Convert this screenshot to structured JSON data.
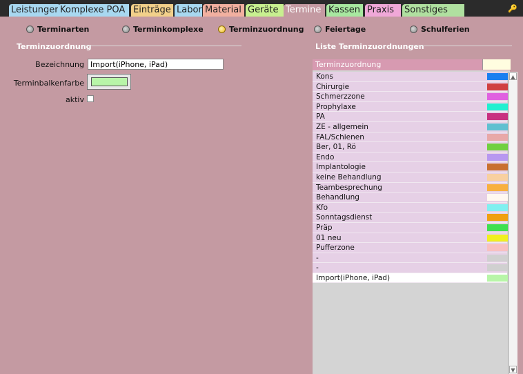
{
  "tabs": [
    {
      "label": "Leistungen",
      "color": "#a8d8f0"
    },
    {
      "label": "Komplexe POA",
      "color": "#a8d8f0"
    },
    {
      "label": "Einträge",
      "color": "#f2d08a"
    },
    {
      "label": "Labor",
      "color": "#a8d8f0"
    },
    {
      "label": "Material",
      "color": "#f2b0a0"
    },
    {
      "label": "Geräte",
      "color": "#c8f090"
    },
    {
      "label": "Termine",
      "color": "#c49aa2",
      "active": true
    },
    {
      "label": "Kassen",
      "color": "#a8e8a0"
    },
    {
      "label": "Praxis",
      "color": "#f0a8d8"
    },
    {
      "label": "Sonstiges",
      "color": "#b0e0a0"
    }
  ],
  "toolbar_icon": "key-icon",
  "radios": [
    {
      "label": "Terminarten",
      "selected": false
    },
    {
      "label": "Terminkomplexe",
      "selected": false
    },
    {
      "label": "Terminzuordnung",
      "selected": true
    },
    {
      "label": "Feiertage",
      "selected": false
    },
    {
      "label": "Schulferien",
      "selected": false
    }
  ],
  "left_section": {
    "title": "Terminzuordnung"
  },
  "form": {
    "bezeichnung_label": "Bezeichnung",
    "bezeichnung_value": "Import(iPhone, iPad)",
    "farbe_label": "Terminbalkenfarbe",
    "farbe_color": "#b8f5a8",
    "aktiv_label": "aktiv"
  },
  "right_section": {
    "title": "Liste Terminzuordnungen"
  },
  "list": {
    "header": "Terminzuordnung",
    "rows": [
      {
        "name": "Kons",
        "color": "#1a7ff0"
      },
      {
        "name": "Chirurgie",
        "color": "#d04040"
      },
      {
        "name": "Schmerzzone",
        "color": "#e060e0"
      },
      {
        "name": "Prophylaxe",
        "color": "#20f0d0"
      },
      {
        "name": "PA",
        "color": "#c83080"
      },
      {
        "name": "ZE - allgemein",
        "color": "#60c0d0"
      },
      {
        "name": "FAL/Schienen",
        "color": "#e8a8a8"
      },
      {
        "name": "Ber, 01, Rö",
        "color": "#70d040"
      },
      {
        "name": "Endo",
        "color": "#b898f0"
      },
      {
        "name": "Implantologie",
        "color": "#c87030"
      },
      {
        "name": "keine Behandlung",
        "color": "#f8d0a0"
      },
      {
        "name": "Teambesprechung",
        "color": "#f8b040"
      },
      {
        "name": "Behandlung",
        "color": "#fff8f0"
      },
      {
        "name": "Kfo",
        "color": "#80f0f0"
      },
      {
        "name": "Sonntagsdienst",
        "color": "#f0a010"
      },
      {
        "name": "Präp",
        "color": "#40e050"
      },
      {
        "name": "01 neu",
        "color": "#f0f020"
      },
      {
        "name": "Pufferzone",
        "color": "#f8c0c0"
      },
      {
        "name": "-",
        "color": "#d0d0d0"
      },
      {
        "name": "-",
        "color": "#d0d0d0"
      },
      {
        "name": "Import(iPhone, iPad)",
        "color": "#b8f5a8",
        "selected": true
      }
    ]
  }
}
